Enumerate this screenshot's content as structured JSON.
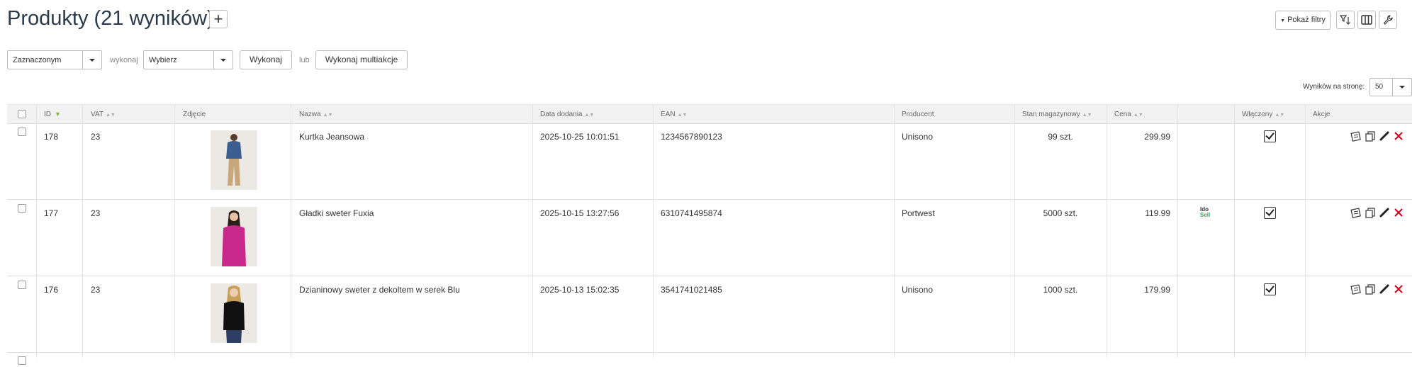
{
  "header": {
    "title": "Produkty (21 wyników)",
    "add_label": "+",
    "show_filters_label": "Pokaż filtry"
  },
  "toolbar": {
    "scope_value": "Zaznaczonym",
    "exec_label_text": "wykonaj",
    "action_value": "Wybierz",
    "execute_button": "Wykonaj",
    "or_text": "lub",
    "multi_button": "Wykonaj multiakcje"
  },
  "pagination": {
    "per_page_label": "Wyników na stronę:",
    "per_page_value": "50"
  },
  "table": {
    "columns": {
      "id": "ID",
      "vat": "VAT",
      "photo": "Zdjęcie",
      "name": "Nazwa",
      "date": "Data dodania",
      "ean": "EAN",
      "producer": "Producent",
      "stock": "Stan magazynowy",
      "price": "Cena",
      "enabled": "Włączony",
      "actions": "Akcje"
    },
    "rows": [
      {
        "id": "178",
        "vat": "23",
        "name": "Kurtka Jeansowa",
        "date": "2025-10-25 10:01:51",
        "ean": "1234567890123",
        "producer": "Unisono",
        "stock": "99 szt.",
        "price": "299.99",
        "badge": "",
        "enabled": true
      },
      {
        "id": "177",
        "vat": "23",
        "name": "Gładki sweter Fuxia",
        "date": "2025-10-15 13:27:56",
        "ean": "6310741495874",
        "producer": "Portwest",
        "stock": "5000 szt.",
        "price": "119.99",
        "badge_top": "Ido",
        "badge_bottom": "Sell",
        "enabled": true
      },
      {
        "id": "176",
        "vat": "23",
        "name": "Dzianinowy sweter z dekoltem w serek Blu",
        "date": "2025-10-13 15:02:35",
        "ean": "3541741021485",
        "producer": "Unisono",
        "stock": "1000 szt.",
        "price": "179.99",
        "badge": "",
        "enabled": true
      }
    ]
  },
  "colors": {
    "sort_active": "#8db43a",
    "delete_red": "#d0021b",
    "idosell_green": "#2eaa5a"
  }
}
